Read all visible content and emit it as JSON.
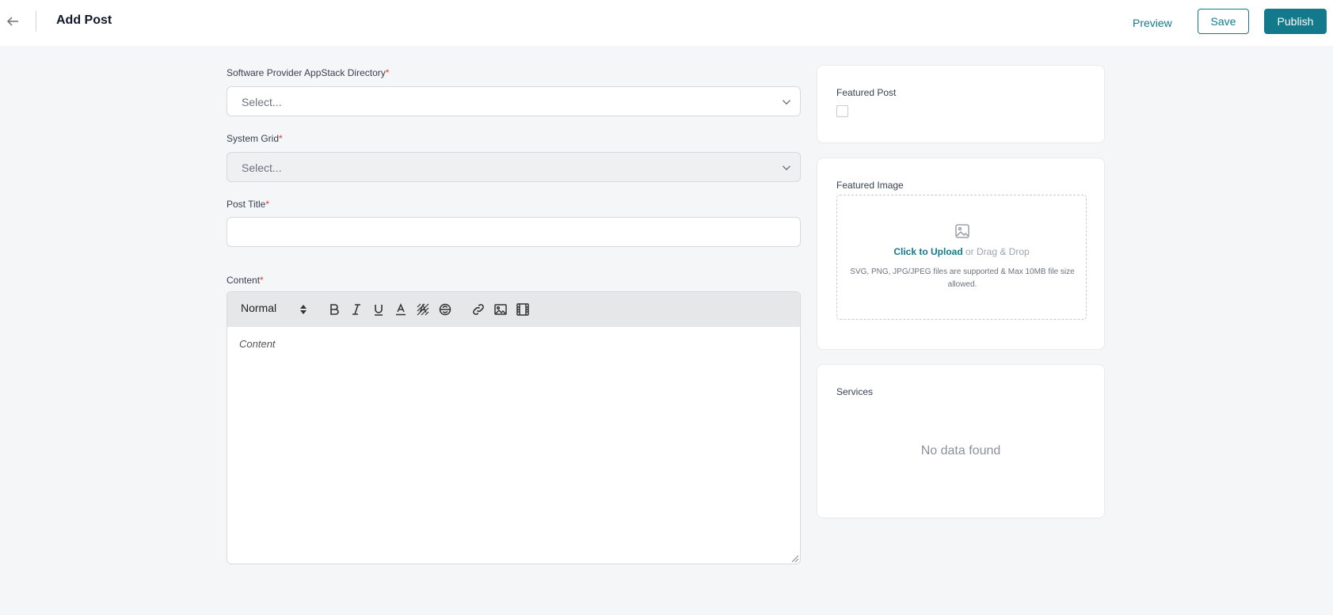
{
  "header": {
    "title": "Add Post",
    "preview_label": "Preview",
    "save_label": "Save",
    "publish_label": "Publish"
  },
  "form": {
    "directory": {
      "label": "Software Provider AppStack Directory",
      "required_mark": "*",
      "placeholder": "Select..."
    },
    "system_grid": {
      "label": "System Grid",
      "required_mark": "*",
      "placeholder": "Select..."
    },
    "post_title": {
      "label": "Post Title",
      "required_mark": "*",
      "value": ""
    },
    "content": {
      "label": "Content",
      "required_mark": "*",
      "placeholder": "Content",
      "format_value": "Normal",
      "toolbar_icons": [
        "bold-icon",
        "italic-icon",
        "underline-icon",
        "font-color-icon",
        "background-color-icon",
        "strikethrough-icon",
        "link-icon",
        "image-icon",
        "video-icon"
      ]
    }
  },
  "sidebar": {
    "featured_post": {
      "title": "Featured Post",
      "checked": false
    },
    "featured_image": {
      "title": "Featured Image",
      "upload_link": "Click to Upload",
      "upload_rest": " or Drag & Drop",
      "hint": "SVG, PNG, JPG/JPEG files are supported & Max 10MB file size allowed."
    },
    "services": {
      "title": "Services",
      "empty_text": "No data found"
    }
  },
  "colors": {
    "accent": "#137a8c",
    "required": "#e53935",
    "background": "#f5f6f8",
    "toolbar": "#e6e7e9"
  }
}
